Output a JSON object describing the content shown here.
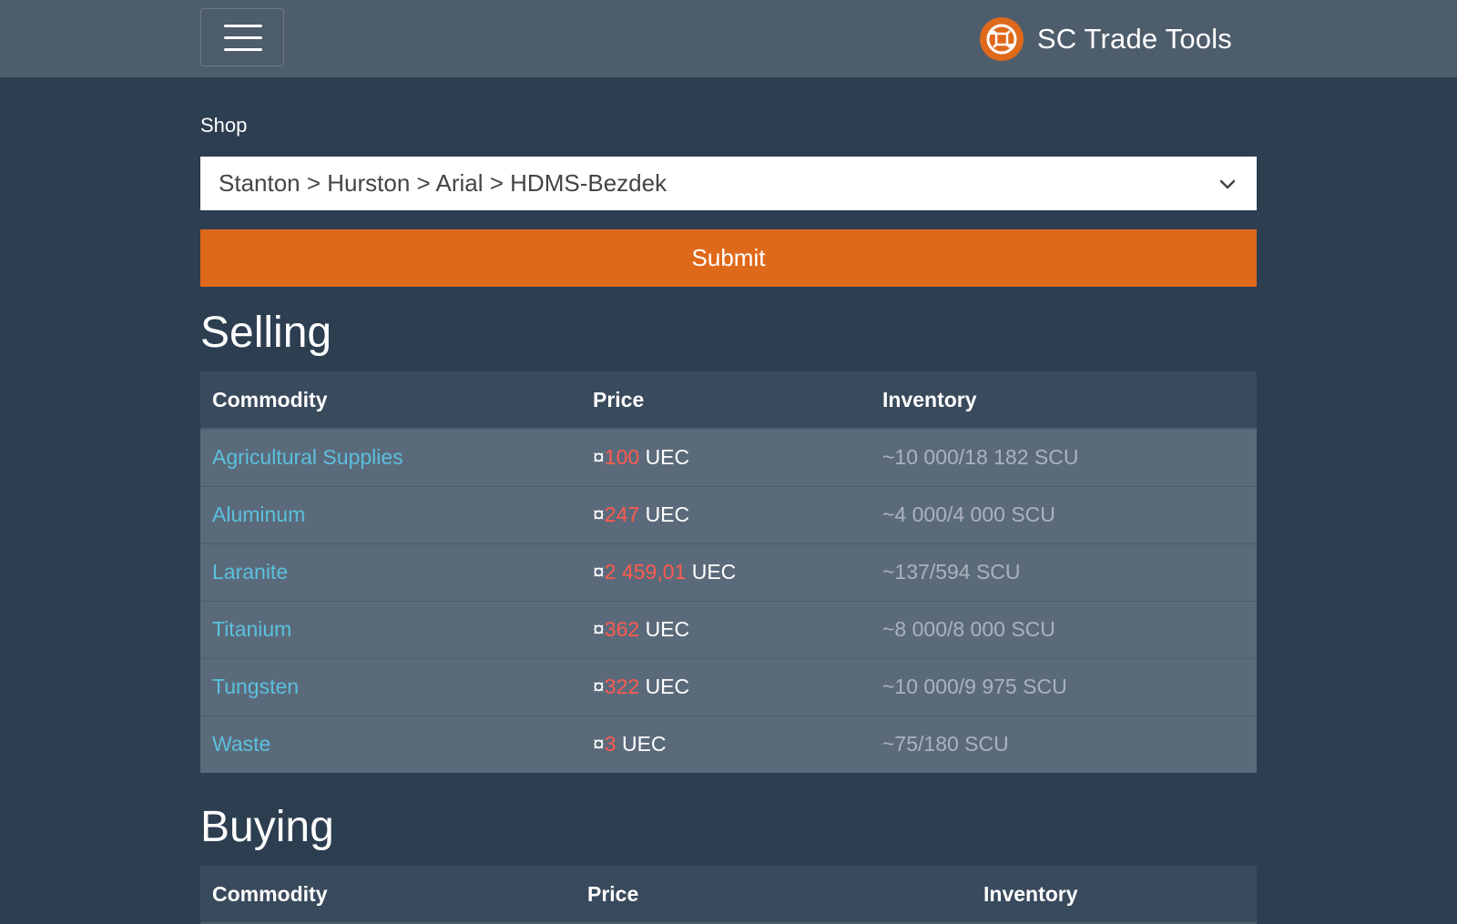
{
  "navbar": {
    "brand": "SC Trade Tools",
    "menu_icon": "hamburger-menu-icon",
    "logo_icon": "trade-cycle-logo-icon",
    "colors": {
      "background": "#4e5d6c",
      "logo": "#df691a"
    }
  },
  "shop": {
    "label": "Shop",
    "selected": "Stanton > Hurston > Arial > HDMS-Bezdek"
  },
  "submit": {
    "label": "Submit",
    "color": "#df691a"
  },
  "selling": {
    "title": "Selling",
    "columns": [
      "Commodity",
      "Price",
      "Inventory"
    ],
    "rows": [
      {
        "commodity": "Agricultural Supplies",
        "currency_symbol": "¤",
        "price": "100",
        "unit": "UEC",
        "inventory": "~10 000/18 182 SCU"
      },
      {
        "commodity": "Aluminum",
        "currency_symbol": "¤",
        "price": "247",
        "unit": "UEC",
        "inventory": "~4 000/4 000 SCU"
      },
      {
        "commodity": "Laranite",
        "currency_symbol": "¤",
        "price": "2 459,01",
        "unit": "UEC",
        "inventory": "~137/594 SCU"
      },
      {
        "commodity": "Titanium",
        "currency_symbol": "¤",
        "price": "362",
        "unit": "UEC",
        "inventory": "~8 000/8 000 SCU"
      },
      {
        "commodity": "Tungsten",
        "currency_symbol": "¤",
        "price": "322",
        "unit": "UEC",
        "inventory": "~10 000/9 975 SCU"
      },
      {
        "commodity": "Waste",
        "currency_symbol": "¤",
        "price": "3",
        "unit": "UEC",
        "inventory": "~75/180 SCU"
      }
    ]
  },
  "buying": {
    "title": "Buying",
    "columns": [
      "Commodity",
      "Price",
      "Inventory"
    ]
  }
}
